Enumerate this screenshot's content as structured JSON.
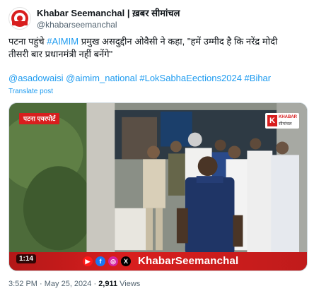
{
  "account": {
    "name": "Khabar Seemanchal | ख़बर सीमांचल",
    "handle": "@khabarseemanchal"
  },
  "tweet": {
    "text_part1": "पटना पहुंचे ",
    "hashtag_aimim": "#AIMIM",
    "text_part2": " प्रमुख असदुद्दीन ओवैसी ने कहा, \"हमें उम्मीद है कि नरेंद्र मोदी तीसरी बार प्रधानमंत्री नहीं बनेंगे\"",
    "tags_line": "@asadowaisi @aimim_national #LokSabhaEections2024 #Bihar",
    "translate_label": "Translate post"
  },
  "video": {
    "location_badge": "पटना एयरपोर्ट",
    "logo_letter": "K",
    "logo_line1": "KHABAR",
    "logo_line2": "सीमांचल",
    "duration": "1:14",
    "brand_text": "KhabarSeemanchal",
    "social_icons": [
      "youtube-icon",
      "facebook-icon",
      "instagram-icon",
      "x-icon"
    ]
  },
  "meta": {
    "time": "3:52 PM",
    "separator": " · ",
    "date": "May 25, 2024",
    "views_count": "2,911",
    "views_label": " Views"
  },
  "colors": {
    "link": "#1d9bf0",
    "brand_red": "#d81e1e",
    "text": "#0f1419",
    "muted": "#536471"
  }
}
